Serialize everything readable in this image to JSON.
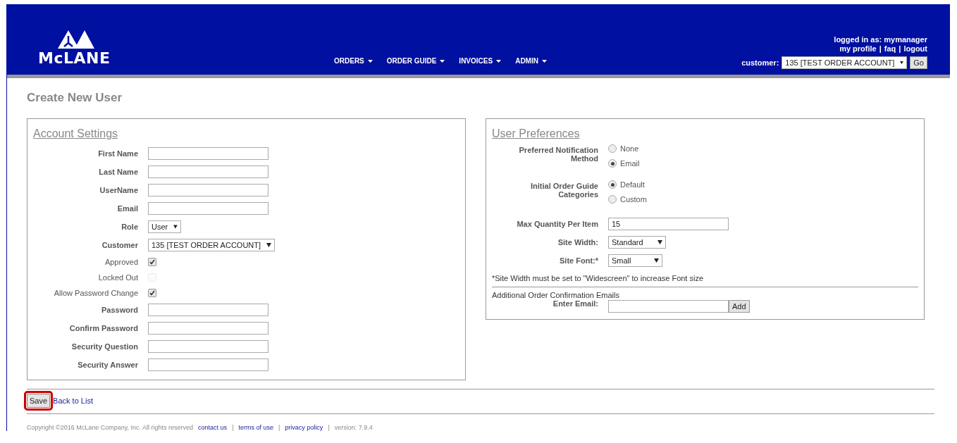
{
  "header": {
    "logo": "McLANE",
    "nav": [
      {
        "label": "ORDERS"
      },
      {
        "label": "ORDER GUIDE"
      },
      {
        "label": "INVOICES"
      },
      {
        "label": "ADMIN"
      }
    ],
    "logged_in_label": "logged in as:",
    "username": "mymanager",
    "links": [
      "my profile",
      "faq",
      "logout"
    ],
    "link_separator": "|",
    "customer_label": "customer:",
    "customer_value": "135 [TEST ORDER ACCOUNT]",
    "go_button": "Go"
  },
  "page_title": "Create New User",
  "account_settings": {
    "title": "Account Settings",
    "fields": [
      {
        "kind": "text",
        "label": "First Name"
      },
      {
        "kind": "text",
        "label": "Last Name"
      },
      {
        "kind": "text",
        "label": "UserName"
      },
      {
        "kind": "text",
        "label": "Email"
      },
      {
        "kind": "select",
        "label": "Role",
        "value": "User",
        "wide": false
      },
      {
        "kind": "select",
        "label": "Customer",
        "value": "135 [TEST ORDER ACCOUNT]",
        "wide": true
      },
      {
        "kind": "checkbox",
        "label": "Approved",
        "checked": true,
        "disabled": false
      },
      {
        "kind": "checkbox",
        "label": "Locked Out",
        "checked": false,
        "disabled": true
      },
      {
        "kind": "checkbox",
        "label": "Allow Password Change",
        "checked": true,
        "disabled": false
      },
      {
        "kind": "text",
        "label": "Password"
      },
      {
        "kind": "text",
        "label": "Confirm Password"
      },
      {
        "kind": "text",
        "label": "Security Question"
      },
      {
        "kind": "text",
        "label": "Security Answer"
      }
    ]
  },
  "user_preferences": {
    "title": "User Preferences",
    "fields": [
      {
        "kind": "radio",
        "label": "Preferred Notification Method",
        "options": [
          {
            "label": "None",
            "selected": false
          },
          {
            "label": "Email",
            "selected": true
          }
        ]
      },
      {
        "kind": "radio",
        "label": "Initial Order Guide Categories",
        "options": [
          {
            "label": "Default",
            "selected": true
          },
          {
            "label": "Custom",
            "selected": false
          }
        ]
      },
      {
        "kind": "text",
        "label": "Max Quantity Per Item",
        "value": "15"
      },
      {
        "kind": "select",
        "label": "Site Width:",
        "value": "Standard"
      },
      {
        "kind": "select",
        "label": "Site Font:*",
        "value": "Small"
      }
    ],
    "note": "*Site Width must be set to \"Widescreen\" to increase Font size",
    "emails_heading": "Additional Order Confirmation Emails",
    "email_label": "Enter Email:",
    "add_button": "Add"
  },
  "actions": {
    "save": "Save",
    "back_link": "Back to List"
  },
  "footer": {
    "copyright": "Copyright ©2016 McLane Company, Inc. All rights reserved",
    "links": [
      "contact us",
      "terms of use",
      "privacy policy"
    ],
    "separator": "|",
    "version": "version: 7.9.4"
  }
}
